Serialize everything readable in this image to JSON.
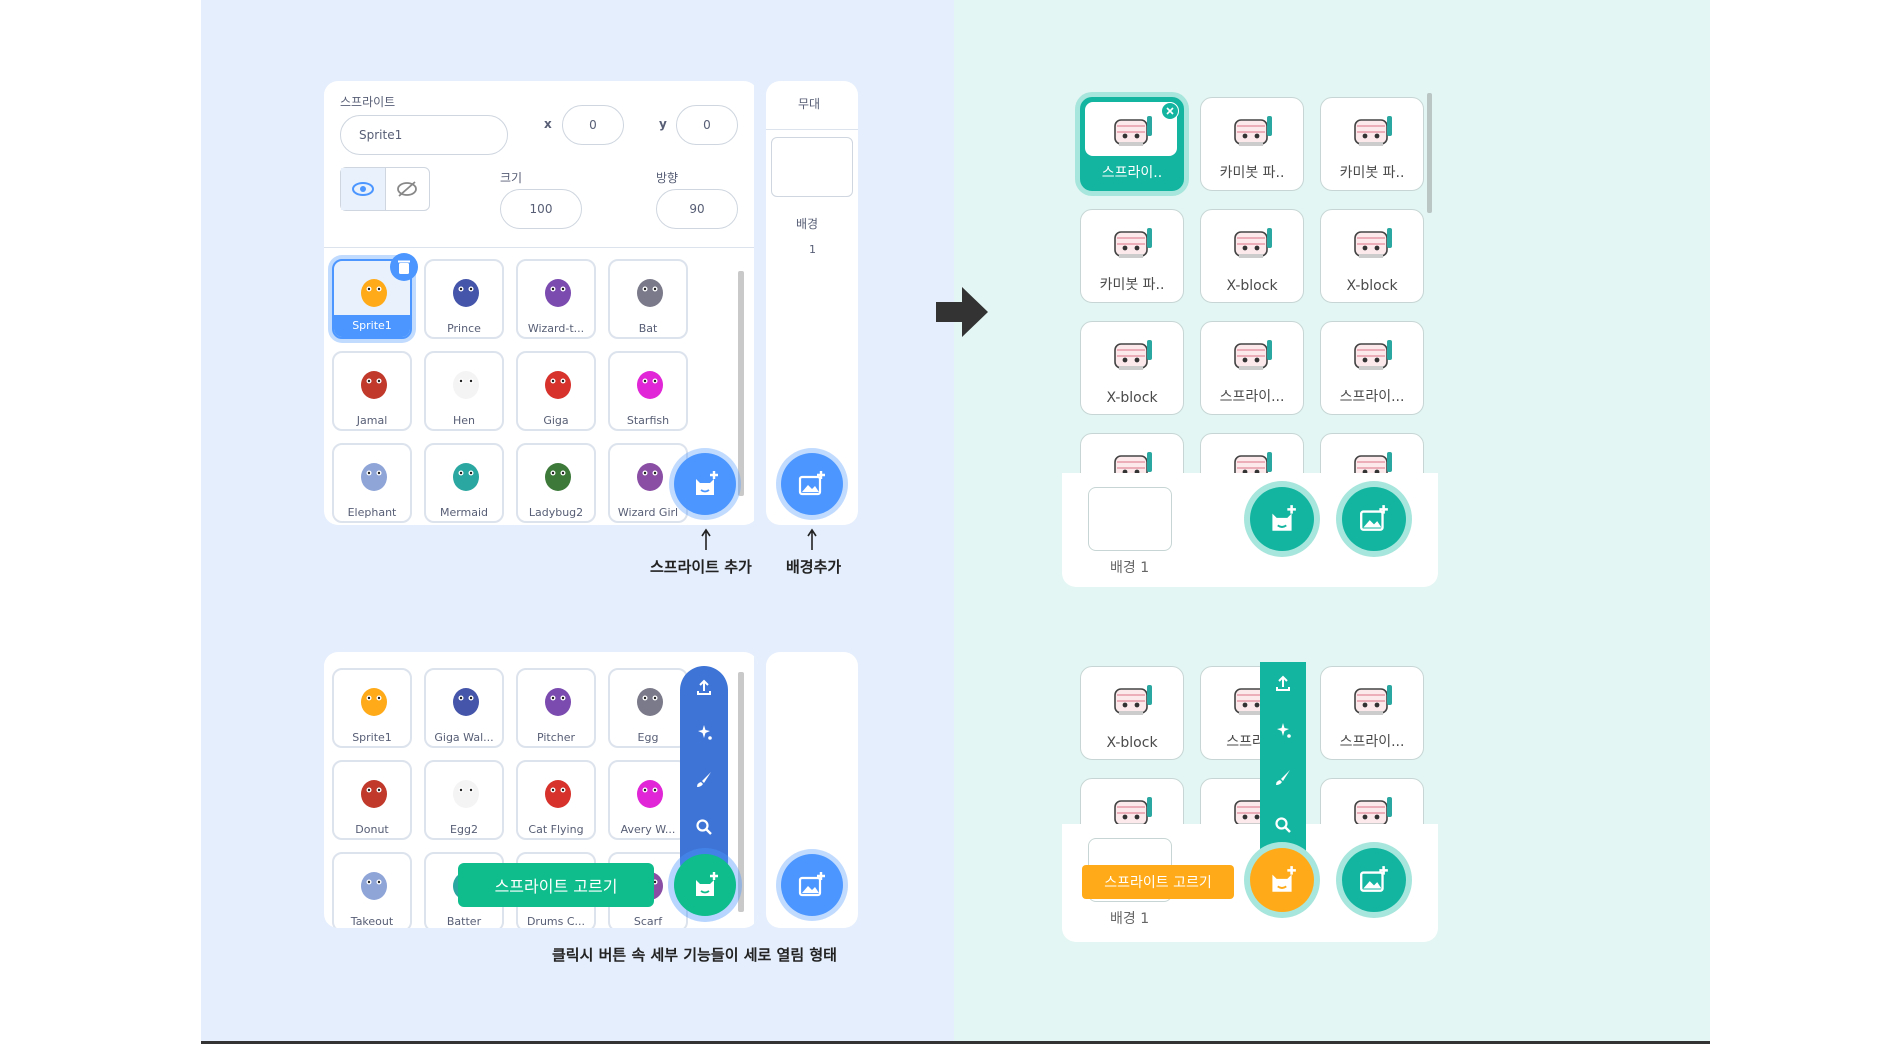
{
  "colors": {
    "scratch_blue": "#4c97ff",
    "scratch_green": "#0fbd8c",
    "teal": "#13b5a0",
    "orange": "#ffab19"
  },
  "left_top": {
    "sprite_label": "스프라이트",
    "sprite_name": "Sprite1",
    "x_label": "x",
    "x_value": "0",
    "y_label": "y",
    "y_value": "0",
    "size_label": "크기",
    "size_value": "100",
    "direction_label": "방향",
    "direction_value": "90",
    "stage_label": "무대",
    "backdrop_label": "배경",
    "backdrop_count": "1",
    "sprites": [
      "Sprite1",
      "Prince",
      "Wizard-t...",
      "Bat",
      "Jamal",
      "Hen",
      "Giga",
      "Starfish",
      "Elephant",
      "Mermaid",
      "Ladybug2",
      "Wizard Girl"
    ],
    "caption_add_sprite": "스프라이트 추가",
    "caption_add_backdrop": "배경추가"
  },
  "left_bottom": {
    "sprites": [
      "Sprite1",
      "Giga Wal...",
      "Pitcher",
      "Egg",
      "Donut",
      "Egg2",
      "Cat Flying",
      "Avery W...",
      "Takeout",
      "Batter",
      "Drums C...",
      "Scarf"
    ],
    "tooltip": "스프라이트 고르기",
    "caption": "클릭시 버튼 속 세부 기능들이 세로 열림 형태"
  },
  "right_top": {
    "sprites": [
      "스프라이..",
      "카미봇 파..",
      "카미봇 파..",
      "카미봇 파..",
      "X-block",
      "X-block",
      "X-block",
      "스프라이...",
      "스프라이..."
    ],
    "backdrop_label": "배경 1"
  },
  "right_bottom": {
    "sprites": [
      "X-block",
      "스프라이",
      "스프라이..."
    ],
    "tooltip": "스프라이트 고르기",
    "backdrop_label": "배경 1"
  }
}
